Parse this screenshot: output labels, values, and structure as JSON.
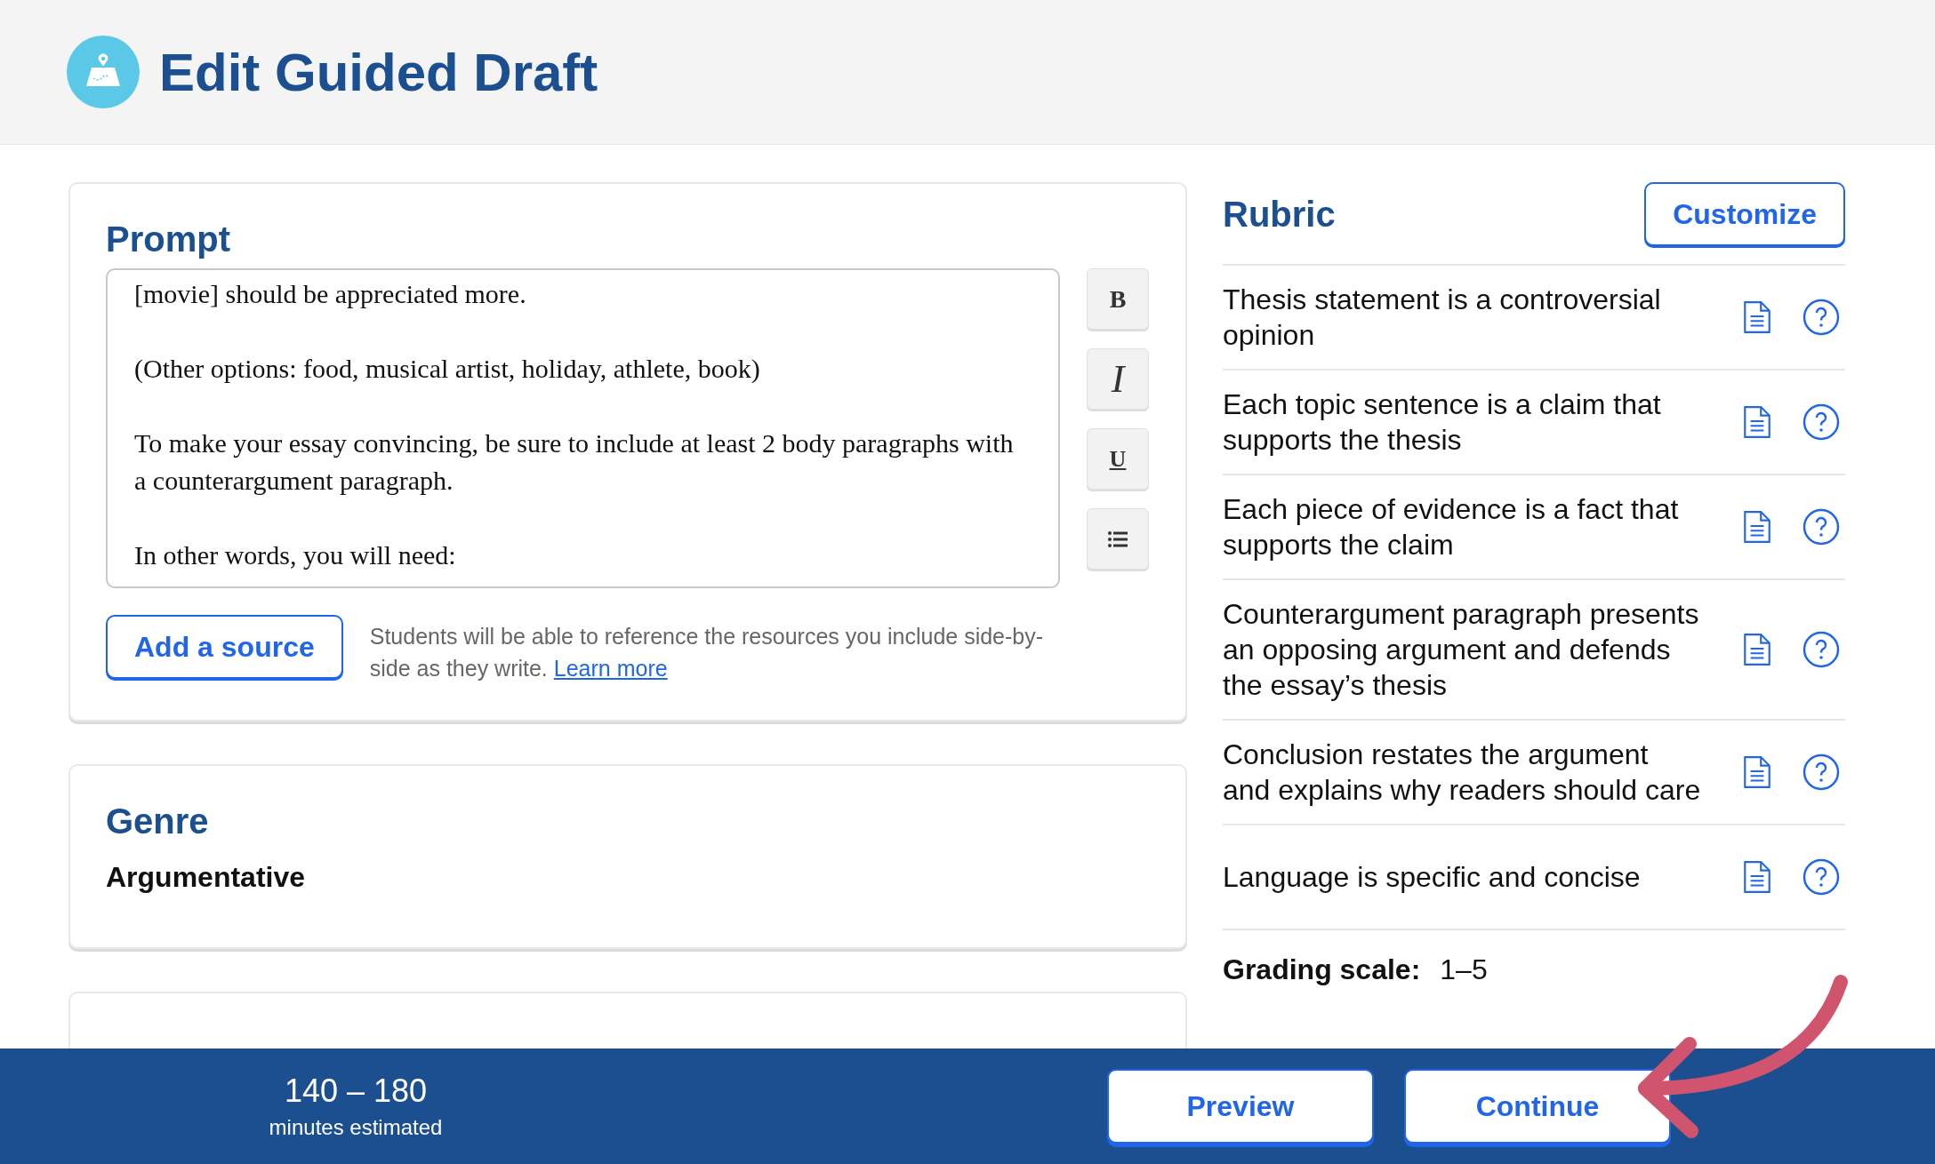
{
  "header": {
    "title": "Edit Guided Draft"
  },
  "prompt": {
    "heading": "Prompt",
    "paragraphs": [
      "[movie] should be appreciated more.",
      "(Other options: food, musical artist, holiday, athlete, book)",
      "To make your essay convincing, be sure to include at least 2 body paragraphs with a counterargument paragraph.",
      "In other words, you will need:"
    ],
    "toolbar": [
      {
        "kind": "bold",
        "label": "B"
      },
      {
        "kind": "italic",
        "label": "I"
      },
      {
        "kind": "underline",
        "label": "U"
      },
      {
        "kind": "list"
      }
    ],
    "add_source_button": "Add a source",
    "help_text": "Students will be able to reference the resources you include side-by-side as they write.",
    "help_link": "Learn more"
  },
  "genre": {
    "heading": "Genre",
    "value": "Argumentative"
  },
  "rubric": {
    "heading": "Rubric",
    "customize_button": "Customize",
    "criteria": [
      "Thesis statement is a controversial opinion",
      "Each topic sentence is a claim that supports the thesis",
      "Each piece of evidence is a fact that supports the claim",
      "Counterargument paragraph presents an opposing argument and defends the essay’s thesis",
      "Conclusion restates the argument and explains why readers should care",
      "Language is specific and concise"
    ],
    "grading_scale_label": "Grading scale:",
    "grading_scale_value": "1–5"
  },
  "footer": {
    "estimate": "140 – 180",
    "estimate_caption": "minutes estimated",
    "buttons": [
      "Preview",
      "Continue"
    ]
  }
}
